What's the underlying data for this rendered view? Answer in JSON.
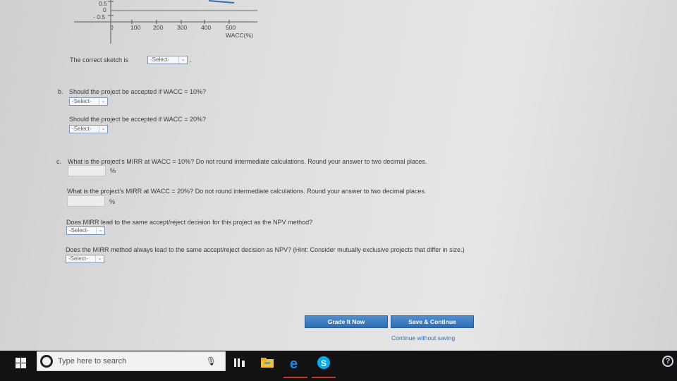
{
  "graph": {
    "y_ticks": [
      "0.5",
      "0",
      "- 0.5"
    ],
    "x_ticks": [
      "0",
      "100",
      "200",
      "300",
      "400",
      "500"
    ],
    "x_axis_label": "WACC(%)"
  },
  "part_a": {
    "text": "The correct sketch is",
    "select_value": "-Select-",
    "trailing": "."
  },
  "part_b": {
    "marker": "b.",
    "q1": "Should the project be accepted if WACC = 10%?",
    "q1_select": "-Select-",
    "q2": "Should the project be accepted if WACC = 20%?",
    "q2_select": "-Select-"
  },
  "part_c": {
    "marker": "c.",
    "q1": "What is the project's MIRR at WACC = 10%? Do not round intermediate calculations. Round your answer to two decimal places.",
    "q1_value": "",
    "q1_unit": "%",
    "q2": "What is the project's MIRR at WACC = 20%? Do not round intermediate calculations. Round your answer to two decimal places.",
    "q2_value": "",
    "q2_unit": "%",
    "q3": "Does MIRR lead to the same accept/reject decision for this project as the NPV method?",
    "q3_select": "-Select-",
    "q4": "Does the MIRR method always lead to the same accept/reject decision as NPV? (Hint: Consider mutually exclusive projects that differ in size.)",
    "q4_select": "-Select-"
  },
  "buttons": {
    "grade": "Grade It Now",
    "save": "Save & Continue",
    "continue_link": "Continue without saving"
  },
  "taskbar": {
    "search_placeholder": "Type here to search",
    "help": "?"
  },
  "colors": {
    "accent": "#2f6eb5",
    "taskbar": "#121212",
    "edge": "#1e88e5",
    "skype": "#00aff0",
    "explorer": "#f0c040"
  }
}
